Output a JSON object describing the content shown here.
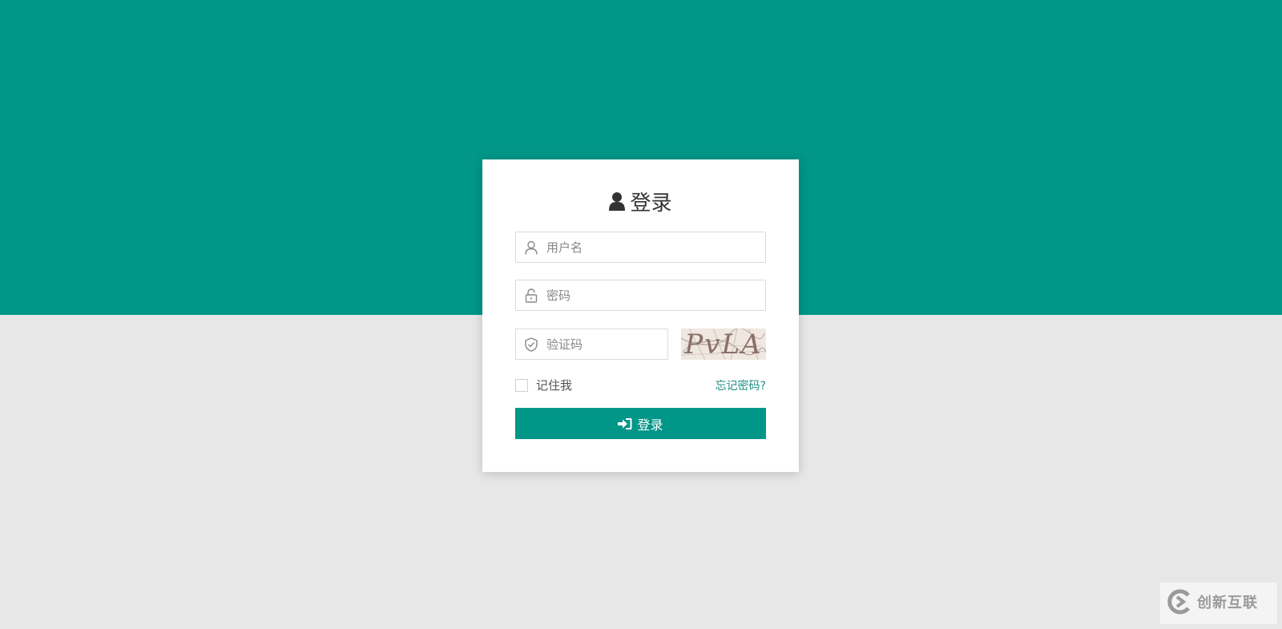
{
  "login": {
    "title": "登录",
    "username_placeholder": "用户名",
    "password_placeholder": "密码",
    "captcha_placeholder": "验证码",
    "captcha_text": "PvLA",
    "remember_label": "记住我",
    "forgot_label": "忘记密码?",
    "submit_label": "登录"
  },
  "watermark": {
    "text": "创新互联"
  },
  "colors": {
    "primary": "#009688",
    "background": "#e7e7e7",
    "link": "#1e8f85"
  }
}
